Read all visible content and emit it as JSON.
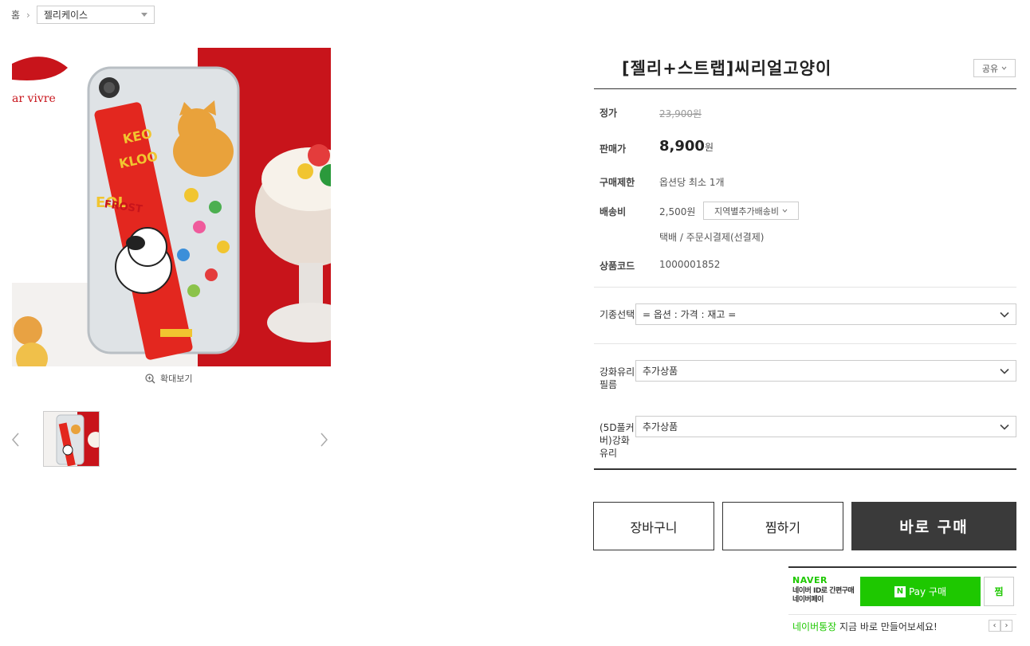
{
  "breadcrumb": {
    "home": "홈",
    "separator": "›",
    "category": "젤리케이스"
  },
  "gallery": {
    "zoom_label": "확대보기"
  },
  "product": {
    "title": "[젤리+스트랩]씨리얼고양이",
    "share_label": "공유"
  },
  "info": {
    "list_price_label": "정가",
    "list_price": "23,900원",
    "sale_price_label": "판매가",
    "sale_price_num": "8,900",
    "sale_price_unit": "원",
    "purchase_limit_label": "구매제한",
    "purchase_limit": "옵션당 최소 1개",
    "shipping_label": "배송비",
    "shipping_fee": "2,500원",
    "shipping_region_button": "지역별추가배송비",
    "shipping_method": "택배  /  주문시결제(선결제)",
    "product_code_label": "상품코드",
    "product_code": "1000001852"
  },
  "options": [
    {
      "label": "기종선택",
      "value": "= 옵션 : 가격 : 재고 ="
    },
    {
      "label": "강화유리필름",
      "value": "추가상품"
    },
    {
      "label": "(5D풀커버)강화유리",
      "value": "추가상품"
    }
  ],
  "actions": {
    "cart": "장바구니",
    "wish": "찜하기",
    "buy": "바로 구매"
  },
  "naverpay": {
    "logo": "NAVER",
    "desc_line1": "네이버 ID로 간편구매",
    "desc_line2": "네이버페이",
    "n_mark": "N",
    "pay_label": "Pay 구매",
    "zzim": "찜",
    "promo_green": "네이버통장",
    "promo_rest": " 지금 바로 만들어보세요!",
    "prev": "‹",
    "next": "›"
  },
  "colors": {
    "naver_green": "#1ec800",
    "buy_button": "#3a3a3a"
  }
}
